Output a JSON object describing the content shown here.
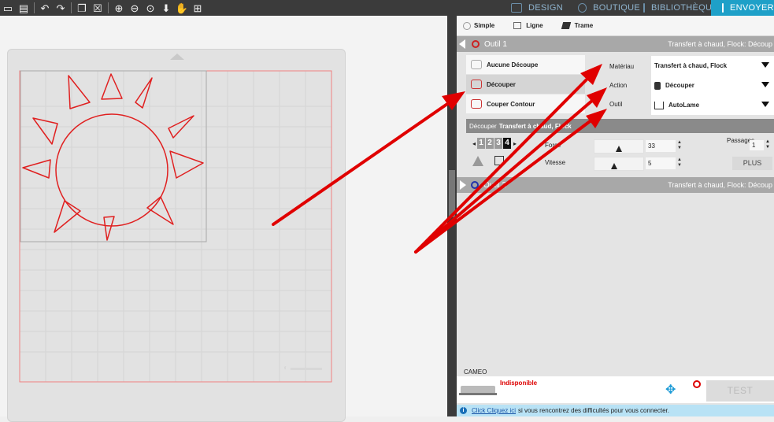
{
  "nav_tabs": [
    {
      "label": "DESIGN",
      "icon": "grid-icon"
    },
    {
      "label": "BOUTIQUE",
      "icon": "store-icon"
    },
    {
      "label": "BIBLIOTHÈQUE",
      "icon": "library-icon"
    },
    {
      "label": "ENVOYER",
      "icon": "send-icon",
      "active": true
    }
  ],
  "modes": {
    "simple": "Simple",
    "ligne": "Ligne",
    "trame": "Trame"
  },
  "tool1": {
    "name": "Outil 1",
    "summary": "Transfert à chaud, Flock: Découp"
  },
  "cut_options": [
    "Aucune Découpe",
    "Découper",
    "Couper Contour"
  ],
  "params": {
    "labels": [
      "Matériau",
      "Action",
      "Outil"
    ],
    "materiau": "Transfert à chaud, Flock",
    "action": "Découper",
    "outil": "AutoLame"
  },
  "subheader": {
    "prefix": "Découper",
    "material": "Transfert à chaud, Flock"
  },
  "pass_numbers": [
    "1",
    "2",
    "3",
    "4"
  ],
  "force": {
    "label": "Force",
    "value": "33",
    "level": 0.5
  },
  "vitesse": {
    "label": "Vitesse",
    "value": "5",
    "level": 0.4
  },
  "passages": {
    "label": "Passages",
    "value": "1"
  },
  "plus_label": "PLUS",
  "tool2": {
    "name": "Outil 2",
    "summary": "Transfert à chaud, Flock: Découp"
  },
  "device": {
    "name": "CAMEO",
    "status": "Indisponible"
  },
  "test_label": "TEST",
  "help": {
    "link": "Click Cliquez ici",
    "text": "si vous rencontrez des difficultés pour vous connecter."
  },
  "colors": {
    "accent": "#1ea0c8",
    "cut_line": "#e02020",
    "arrow": "#e00000",
    "tool1": "#cc2222",
    "tool2": "#2233aa"
  }
}
